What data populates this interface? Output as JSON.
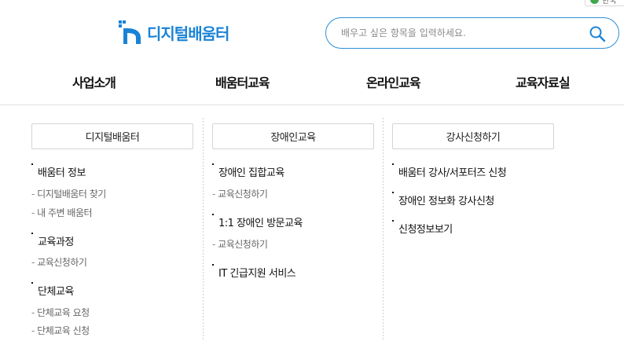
{
  "top_chip": {
    "label": "한국"
  },
  "logo": {
    "text": "디지털배움터"
  },
  "search": {
    "placeholder": "배우고 싶은 항목을 입력하세요."
  },
  "gnb": {
    "items": [
      "사업소개",
      "배움터교육",
      "온라인교육",
      "교육자료실"
    ]
  },
  "columns": [
    {
      "header": "디지털배움터",
      "items": [
        {
          "label": "배움터 정보",
          "subs": [
            "디지털배움터 찾기",
            "내 주변 배움터"
          ]
        },
        {
          "label": "교육과정",
          "subs": [
            "교육신청하기"
          ]
        },
        {
          "label": "단체교육",
          "subs": [
            "단체교육 요청",
            "단체교육 신청"
          ]
        }
      ]
    },
    {
      "header": "장애인교육",
      "items": [
        {
          "label": "장애인 집합교육",
          "subs": [
            "교육신청하기"
          ]
        },
        {
          "label": "1:1 장애인 방문교육",
          "subs": [
            "교육신청하기"
          ]
        },
        {
          "label": "IT 긴급지원 서비스",
          "subs": []
        }
      ]
    },
    {
      "header": "강사신청하기",
      "items": [
        {
          "label": "배움터 강사/서포터즈 신청",
          "subs": []
        },
        {
          "label": "장애인 정보화 강사신청",
          "subs": []
        },
        {
          "label": "신청정보보기",
          "subs": []
        }
      ]
    }
  ],
  "colors": {
    "brand": "#1a83d6",
    "search_border": "#2c8fd6"
  }
}
